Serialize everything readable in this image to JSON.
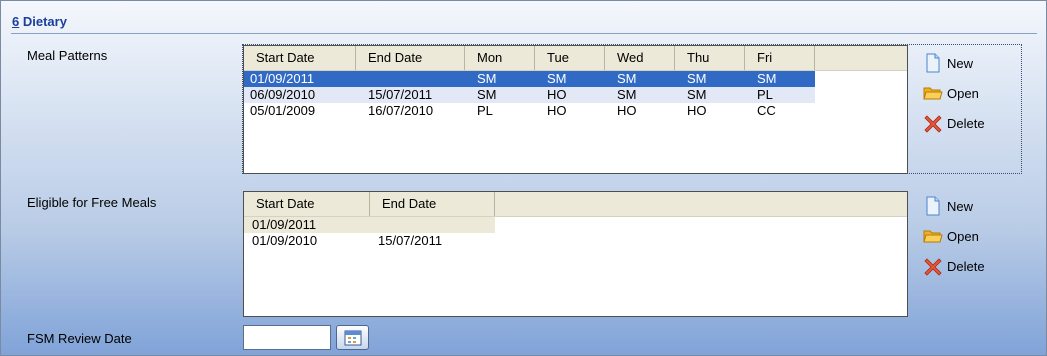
{
  "section": {
    "number": "6",
    "title": "Dietary"
  },
  "meal_patterns": {
    "label": "Meal Patterns",
    "columns": [
      "Start Date",
      "End Date",
      "Mon",
      "Tue",
      "Wed",
      "Thu",
      "Fri"
    ],
    "rows": [
      [
        "01/09/2011",
        "",
        "SM",
        "SM",
        "SM",
        "SM",
        "SM"
      ],
      [
        "06/09/2010",
        "15/07/2011",
        "SM",
        "HO",
        "SM",
        "SM",
        "PL"
      ],
      [
        "05/01/2009",
        "16/07/2010",
        "PL",
        "HO",
        "HO",
        "HO",
        "CC"
      ]
    ],
    "selected_row": 0
  },
  "free_meals": {
    "label": "Eligible for Free Meals",
    "columns": [
      "Start Date",
      "End Date"
    ],
    "rows": [
      [
        "01/09/2011",
        ""
      ],
      [
        "01/09/2010",
        "15/07/2011"
      ]
    ]
  },
  "actions": {
    "new": "New",
    "open": "Open",
    "delete": "Delete"
  },
  "fsm_review": {
    "label": "FSM Review Date",
    "value": ""
  },
  "icons": {
    "new": "new-document-icon",
    "open": "open-folder-icon",
    "delete": "delete-x-icon",
    "calendar": "calendar-icon"
  },
  "colors": {
    "section_title": "#1a3f9a",
    "selected_row": "#316ac5",
    "alt_row": "#e3e8f6",
    "header_bg": "#ece9d8"
  }
}
